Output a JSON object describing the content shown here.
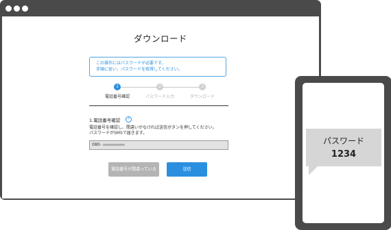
{
  "page": {
    "title": "ダウンロード",
    "notice": [
      "この操作にはパスワードが必要です。",
      "手順に従い、パスワードを取得してください。"
    ],
    "steps": [
      {
        "number": "1",
        "label": "電話番号確認",
        "active": true
      },
      {
        "number": "2",
        "label": "パスワード入力",
        "active": false
      },
      {
        "number": "3",
        "label": "ダウンロード",
        "active": false
      }
    ],
    "section_title": "1.電話番号確認",
    "help_icon": "?",
    "description": [
      "電話番号を確認し、間違いがなければ送信ボタンを押してください。",
      "パスワードがSMSで届きます。"
    ],
    "phone_number_prefix": "080-",
    "buttons": {
      "wrong_number": "電話番号が間違っている",
      "send": "送信"
    }
  },
  "sms": {
    "label": "パスワード",
    "value": "1234"
  },
  "colors": {
    "accent": "#2b8fe0",
    "frame": "#4a4a4a",
    "bubble": "#d6d6d6"
  }
}
